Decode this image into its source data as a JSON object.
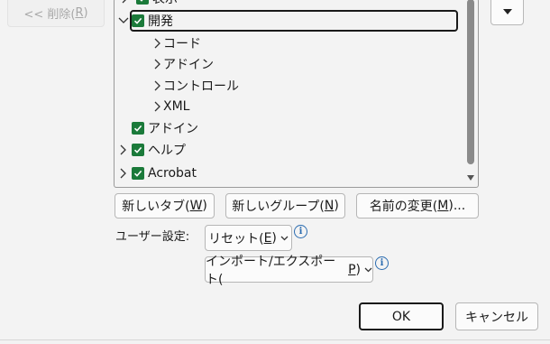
{
  "remove_button": {
    "prefix": "<< 削除(",
    "mnemonic": "R",
    "suffix": ")"
  },
  "tree": {
    "partial_top_label": "表示",
    "selected_item": "開発",
    "children": [
      "コード",
      "アドイン",
      "コントロール",
      "XML"
    ],
    "root_items": [
      "アドイン",
      "ヘルプ",
      "Acrobat"
    ]
  },
  "buttons": {
    "new_tab": {
      "prefix": "新しいタブ(",
      "mnemonic": "W",
      "suffix": ")"
    },
    "new_group": {
      "prefix": "新しいグループ(",
      "mnemonic": "N",
      "suffix": ")"
    },
    "rename": {
      "prefix": "名前の変更(",
      "mnemonic": "M",
      "suffix": ")..."
    },
    "reset": {
      "prefix": "リセット(",
      "mnemonic": "E",
      "suffix": ")"
    },
    "import_export": {
      "prefix": "インポート/エクスポート(",
      "mnemonic": "P",
      "suffix": ")"
    },
    "ok": "OK",
    "cancel": "キャンセル"
  },
  "user_settings_label": "ユーザー設定:",
  "colors": {
    "checkbox": "#1b7a3a",
    "info": "#2b6cb0"
  }
}
